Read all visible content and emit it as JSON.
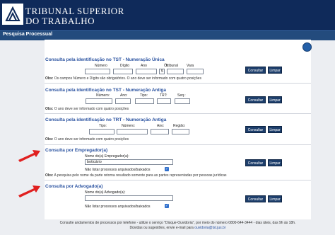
{
  "header": {
    "title_line1": "TRIBUNAL SUPERIOR",
    "title_line2": "DO TRABALHO",
    "page_label": "Pesquisa Processual"
  },
  "sections": {
    "tst_unica": {
      "title": "Consulta pela identificação no TST - Numeração Única",
      "fields": [
        "Número",
        "Dígito",
        "Ano",
        "Ór.",
        "Tribunal",
        "Vara"
      ],
      "values": [
        "",
        "",
        "",
        "5",
        "",
        ""
      ],
      "obs_label": "Obs:",
      "obs": "Os campos Número e Dígito são obrigatórios. O ano deve ser informado com quatro posições"
    },
    "tst_antiga": {
      "title": "Consulta pela identificação no TST - Numeração Antiga",
      "fields": [
        "Número:",
        "Ano:",
        "Tipo:",
        "TRT:",
        "Seq.:"
      ],
      "obs_label": "Obs:",
      "obs": "O ano deve ser informado com quatro posições"
    },
    "trt_antiga": {
      "title": "Consulta pela identificação no TRT - Numeração Antiga",
      "fields": [
        "Tipo:",
        "Número:",
        "Ano:",
        "Região:"
      ],
      "obs_label": "Obs:",
      "obs": "O ano deve ser informado com quatro posições"
    },
    "empregador": {
      "title": "Consulta por Empregador(a)",
      "field_label": "Nome do(a) Empregador(a):",
      "field_value": "boticário",
      "checkbox_label": "Não listar processos arquivados/baixados",
      "checkbox_checked": true,
      "obs_label": "Obs:",
      "obs": "A pesquisa pelo nome da parte retorna resultado somente para as partes representadas por pessoas jurídicas"
    },
    "advogado": {
      "title": "Consulta por Advogado(a)",
      "field_label": "Nome do(a) Advogado(a):",
      "field_value": "",
      "checkbox_label": "Não listar processos arquivados/baixados",
      "checkbox_checked": true
    }
  },
  "buttons": {
    "consultar": "Consultar",
    "limpar": "Limpar"
  },
  "footer": {
    "line1": "Consulte andamentos de processos por telefone - utilize o serviço \"Disque-Ouvidoria\", por meio do número 0800-644-3444 - dias úteis, das 9h às 18h.",
    "line2_pre": "Dúvidas ou sugestões, envie e-mail para ",
    "email": "ouvidoria@tst.jus.br"
  },
  "colors": {
    "header": "#0f2a5a",
    "subbar": "#234b7d",
    "title": "#2a52a0",
    "button": "#1d3e6b",
    "arrow": "#e02020"
  }
}
